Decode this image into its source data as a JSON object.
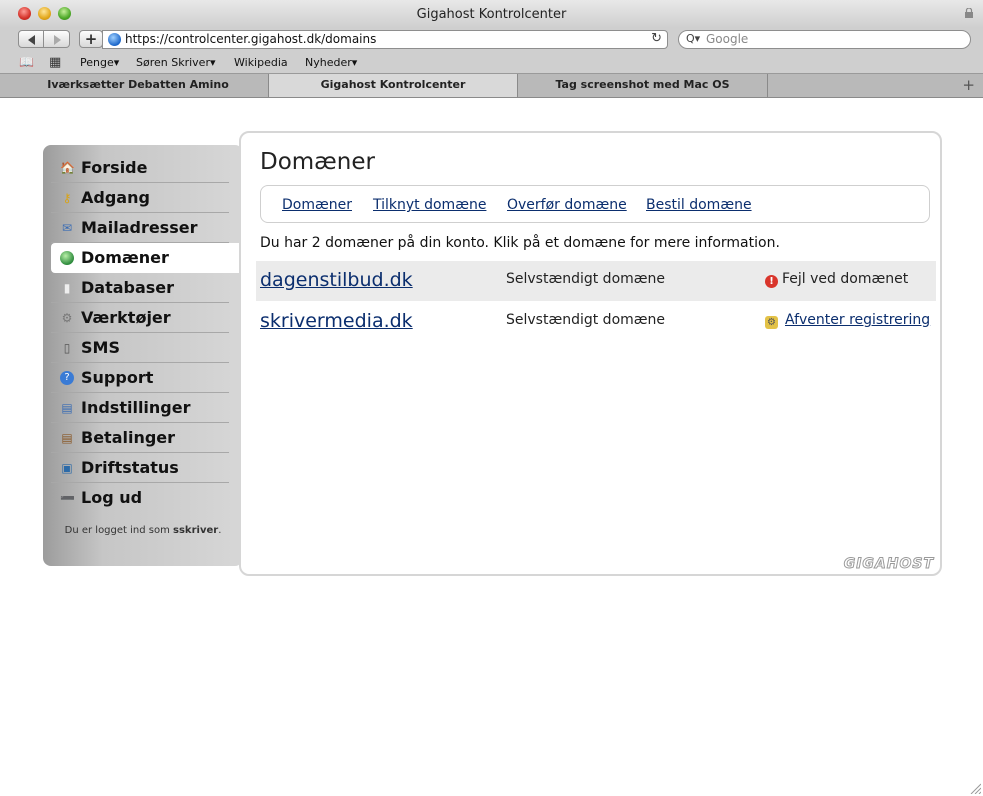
{
  "window": {
    "title": "Gigahost Kontrolcenter"
  },
  "toolbar": {
    "url": "https://controlcenter.gigahost.dk/domains",
    "search_placeholder": "Google"
  },
  "bookmarks": [
    {
      "label": "Penge▾"
    },
    {
      "label": "Søren Skriver▾"
    },
    {
      "label": "Wikipedia"
    },
    {
      "label": "Nyheder▾"
    }
  ],
  "tabs": [
    {
      "label": "Iværksætter Debatten Amino",
      "active": false
    },
    {
      "label": "Gigahost Kontrolcenter",
      "active": true
    },
    {
      "label": "Tag screenshot med Mac OS",
      "active": false
    }
  ],
  "sidebar": {
    "items": [
      {
        "label": "Forside",
        "icon": "home-icon"
      },
      {
        "label": "Adgang",
        "icon": "key-icon"
      },
      {
        "label": "Mailadresser",
        "icon": "envelope-icon"
      },
      {
        "label": "Domæner",
        "icon": "globe-icon",
        "active": true
      },
      {
        "label": "Databaser",
        "icon": "database-icon"
      },
      {
        "label": "Værktøjer",
        "icon": "gear-icon"
      },
      {
        "label": "SMS",
        "icon": "phone-icon"
      },
      {
        "label": "Support",
        "icon": "help-icon"
      },
      {
        "label": "Indstillinger",
        "icon": "id-card-icon"
      },
      {
        "label": "Betalinger",
        "icon": "invoice-icon"
      },
      {
        "label": "Driftstatus",
        "icon": "monitor-icon"
      },
      {
        "label": "Log ud",
        "icon": "logout-icon"
      }
    ],
    "logged_in_prefix": "Du er logget ind som ",
    "logged_in_user": "sskriver",
    "logged_in_suffix": "."
  },
  "main": {
    "title": "Domæner",
    "subnav": [
      "Domæner",
      "Tilknyt domæne",
      "Overfør domæne",
      "Bestil domæne"
    ],
    "info": "Du har 2 domæner på din konto. Klik på et domæne for mere information.",
    "domains": [
      {
        "name": "dagenstilbud.dk",
        "type": "Selvstændigt domæne",
        "status": "Fejl ved domænet",
        "status_icon": "error-icon",
        "status_link": false
      },
      {
        "name": "skrivermedia.dk",
        "type": "Selvstændigt domæne",
        "status": "Afventer registrering",
        "status_icon": "pending-icon",
        "status_link": true
      }
    ],
    "brand": "GIGAHOST"
  },
  "colors": {
    "link": "#0b2e6e",
    "error": "#d9352b",
    "sidebar": "#c6c6c6"
  }
}
